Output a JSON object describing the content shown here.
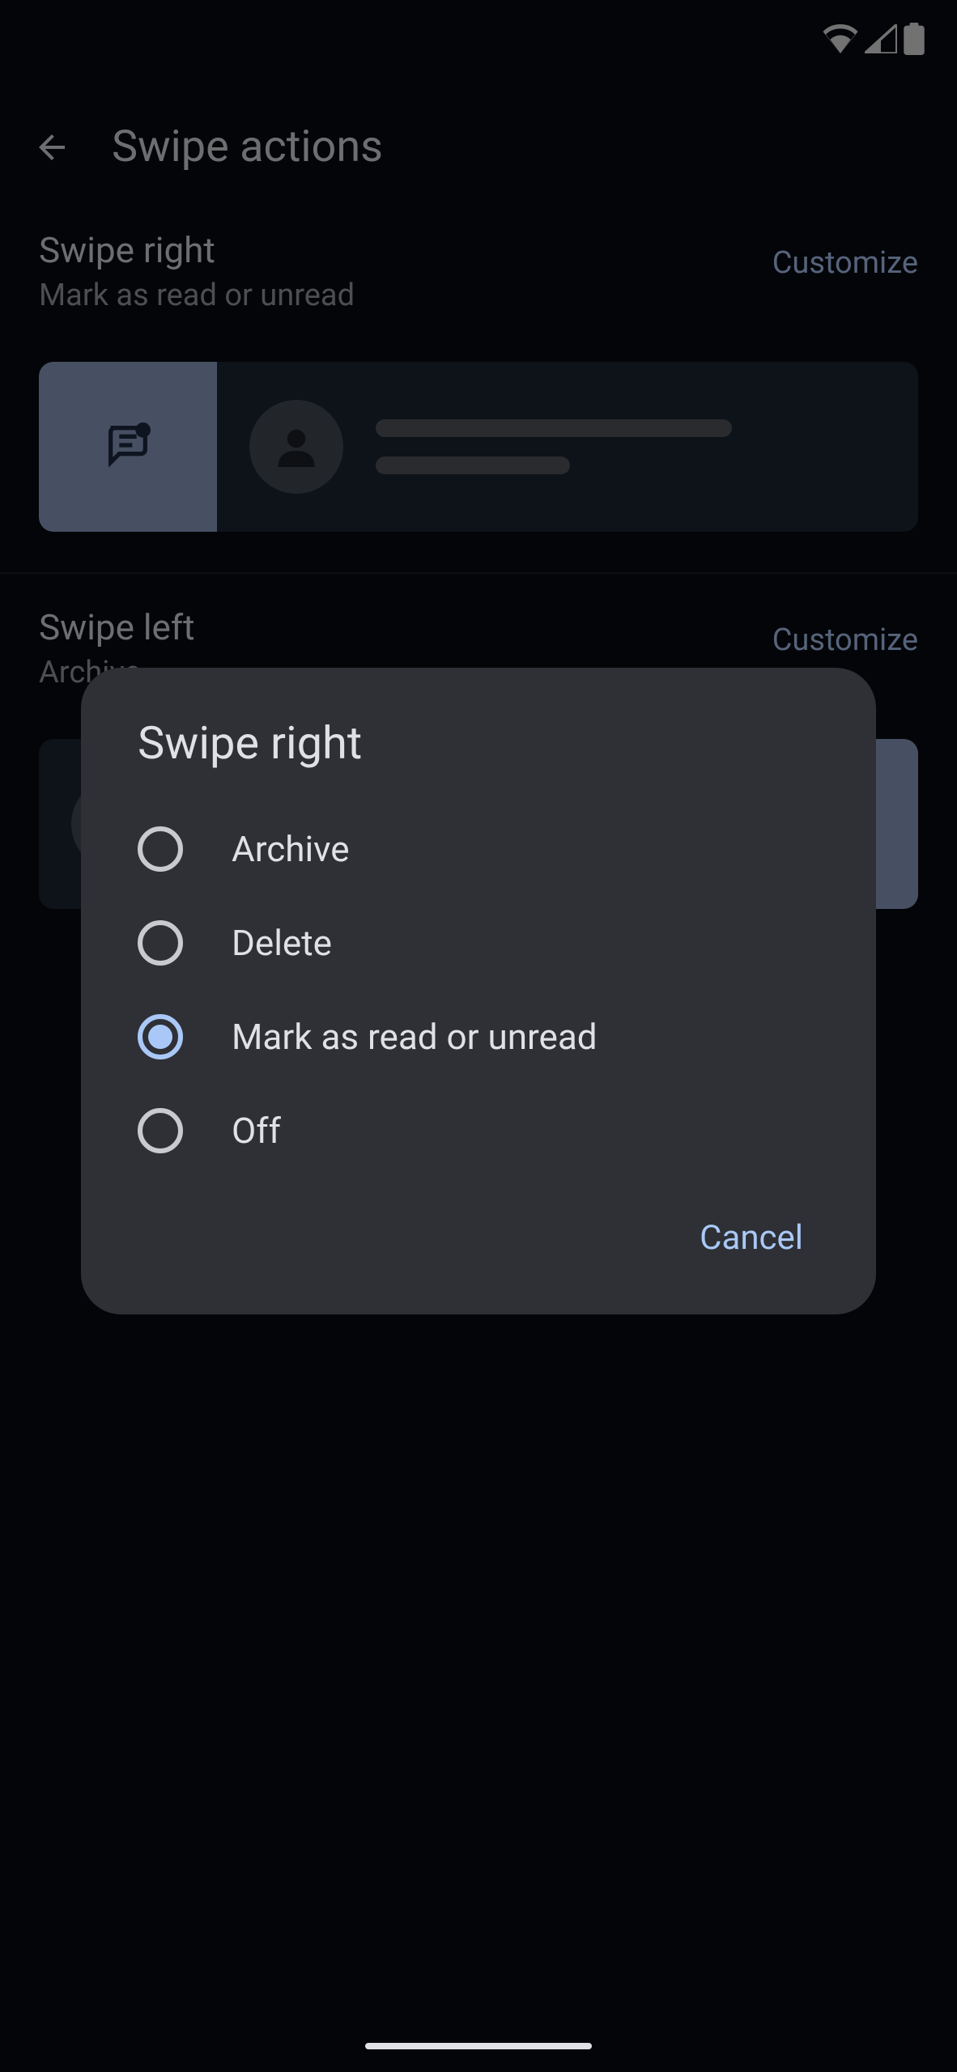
{
  "status_bar": {},
  "app_bar": {
    "title": "Swipe actions"
  },
  "sections": {
    "swipe_right": {
      "title": "Swipe right",
      "subtitle": "Mark as read or unread",
      "customize_label": "Customize"
    },
    "swipe_left": {
      "title": "Swipe left",
      "subtitle": "Archive",
      "customize_label": "Customize"
    }
  },
  "dialog": {
    "title": "Swipe right",
    "options": [
      {
        "label": "Archive",
        "selected": false
      },
      {
        "label": "Delete",
        "selected": false
      },
      {
        "label": "Mark as read or unread",
        "selected": true
      },
      {
        "label": "Off",
        "selected": false
      }
    ],
    "cancel_label": "Cancel"
  }
}
